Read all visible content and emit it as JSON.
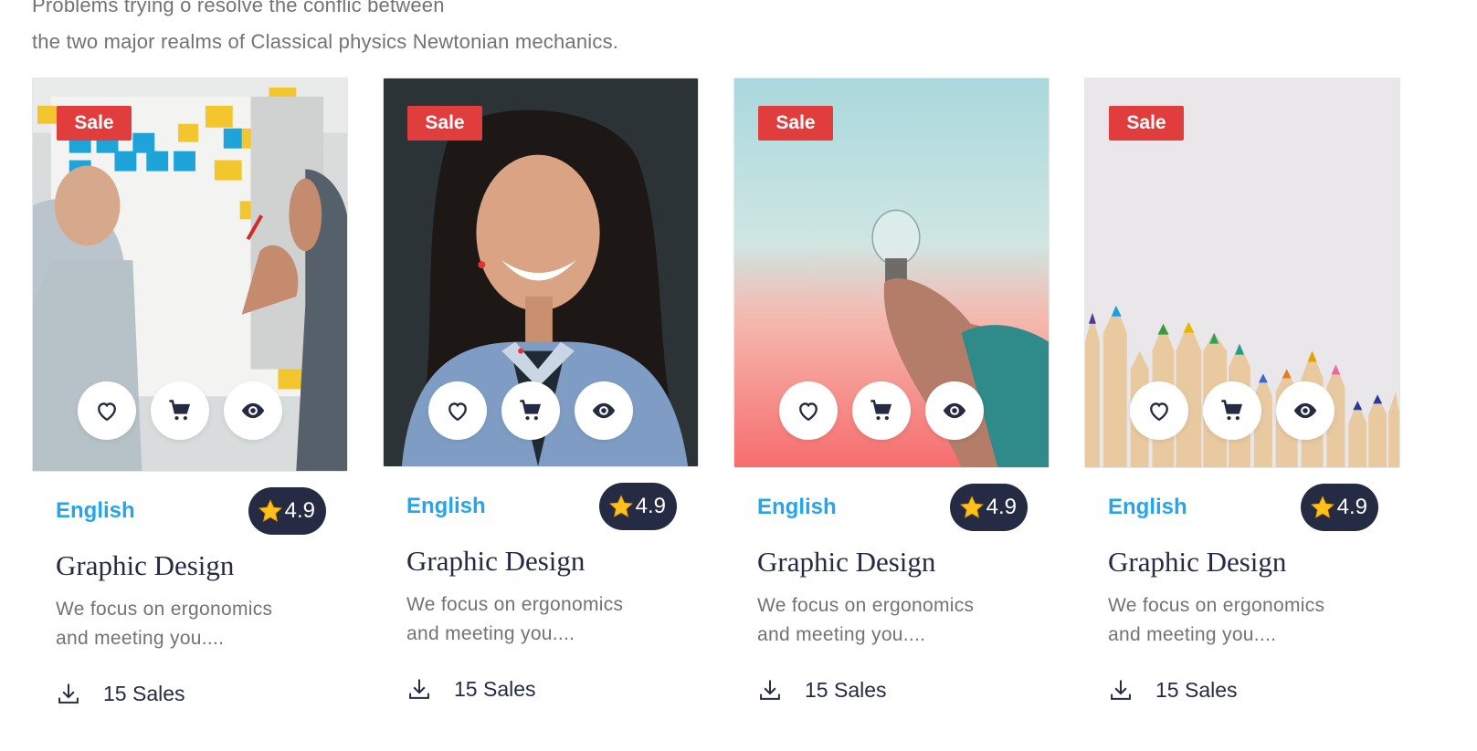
{
  "intro": {
    "line1": "Problems trying o resolve the conflic between",
    "line2": "the two major realms of Classical physics Newtonian mechanics."
  },
  "colors": {
    "accent": "#23a6f0",
    "sale": "#e23d3d",
    "dark": "#252b42",
    "muted": "#737373"
  },
  "cards": [
    {
      "sale": "Sale",
      "category": "English",
      "rating": "4.9",
      "title": "Graphic Design",
      "desc_line1": "We focus on ergonomics",
      "desc_line2": "and meeting you....",
      "sales": "15 Sales",
      "image": "office-sticky-notes"
    },
    {
      "sale": "Sale",
      "category": "English",
      "rating": "4.9",
      "title": "Graphic Design",
      "desc_line1": "We focus on ergonomics",
      "desc_line2": "and meeting you....",
      "sales": "15 Sales",
      "image": "smiling-woman"
    },
    {
      "sale": "Sale",
      "category": "English",
      "rating": "4.9",
      "title": "Graphic Design",
      "desc_line1": "We focus on ergonomics",
      "desc_line2": "and meeting you....",
      "sales": "15 Sales",
      "image": "hand-holding-lightbulb"
    },
    {
      "sale": "Sale",
      "category": "English",
      "rating": "4.9",
      "title": "Graphic Design",
      "desc_line1": "We focus on ergonomics",
      "desc_line2": "and meeting you....",
      "sales": "15 Sales",
      "image": "colored-pencils"
    }
  ],
  "icons": {
    "like": "heart-icon",
    "cart": "cart-icon",
    "view": "eye-icon",
    "rating": "star-icon",
    "sales": "download-icon"
  }
}
